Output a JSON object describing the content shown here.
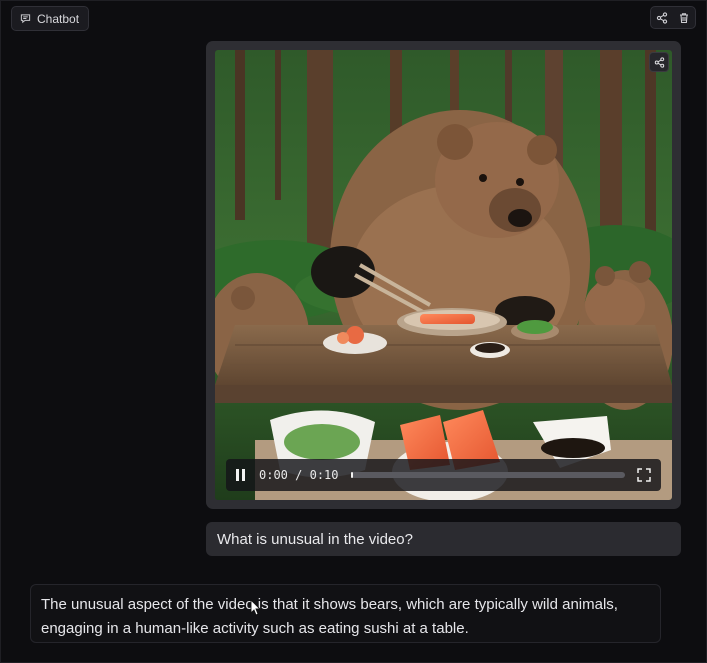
{
  "header": {
    "label": "Chatbot",
    "icons": [
      "chat-icon",
      "share-icon",
      "trash-icon"
    ]
  },
  "video": {
    "time_current": "0:00",
    "time_separator": "/",
    "time_total": "0:10",
    "progress": 0.01,
    "state": "playing",
    "icons": [
      "share-icon",
      "pause-icon",
      "fullscreen-icon"
    ]
  },
  "messages": [
    {
      "role": "user",
      "text": "What is unusual in the video?"
    },
    {
      "role": "bot",
      "text": "The unusual aspect of the video is that it shows bears, which are typically wild animals, engaging in a human-like activity such as eating sushi at a table."
    }
  ],
  "colors": {
    "background": "#0d0d10",
    "panel": "#2b2b30",
    "text": "#e6e6ea"
  }
}
